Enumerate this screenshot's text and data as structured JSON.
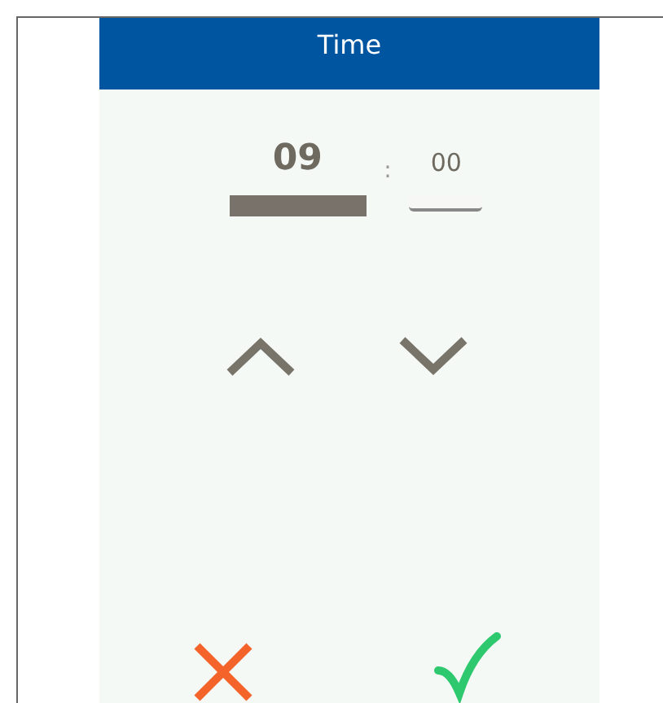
{
  "header": {
    "title": "Time"
  },
  "time_fields": [
    {
      "value": "09",
      "selected": true
    },
    {
      "value": "00",
      "selected": false
    }
  ],
  "separator": ":",
  "steppers": [
    {
      "kind": "up"
    },
    {
      "kind": "down"
    }
  ],
  "actions": [
    {
      "kind": "cancel"
    },
    {
      "kind": "confirm"
    }
  ]
}
